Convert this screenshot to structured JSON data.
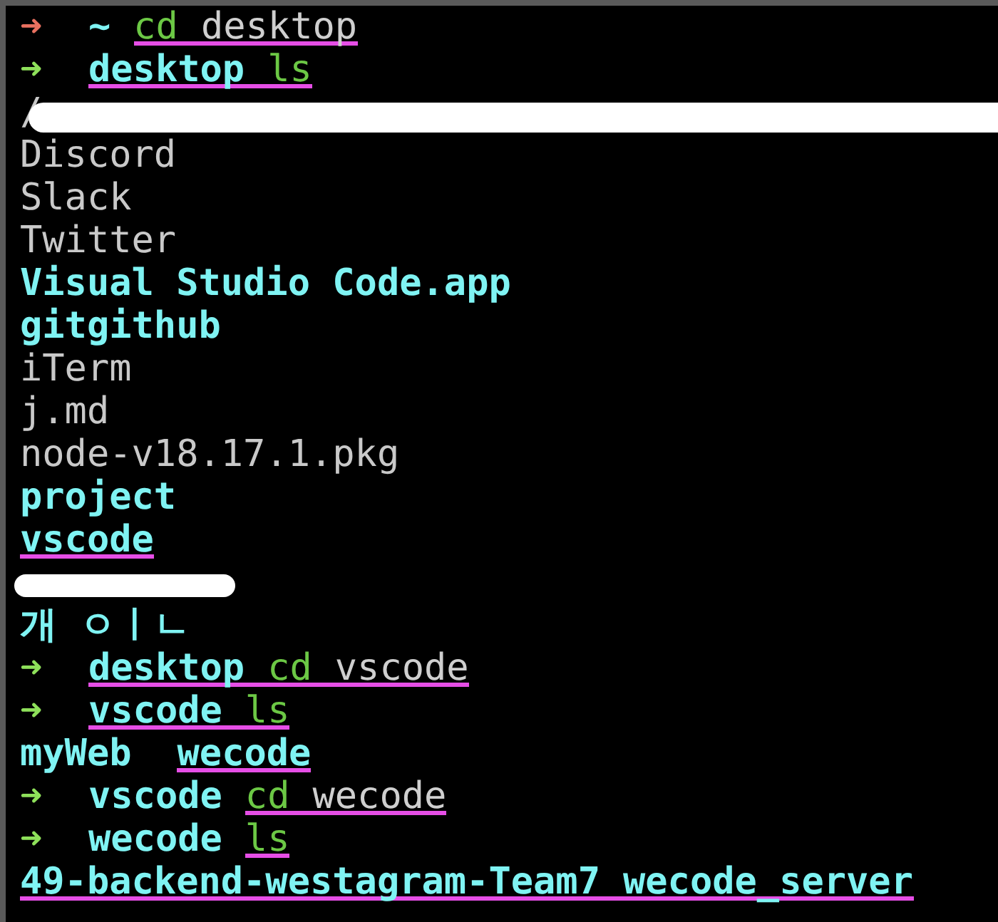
{
  "lines": [
    {
      "kind": "prompt",
      "arrow": "➜",
      "error": true,
      "segments": [
        {
          "text": "~",
          "kind": "dir",
          "marked": false
        },
        {
          "text": "cd",
          "kind": "cmd",
          "marked": true
        },
        {
          "text": "desktop",
          "kind": "arg",
          "marked": true
        }
      ]
    },
    {
      "kind": "prompt",
      "arrow": "➜",
      "error": false,
      "segments": [
        {
          "text": "desktop",
          "kind": "dir",
          "marked": true
        },
        {
          "text": "ls",
          "kind": "cmd",
          "marked": true
        }
      ]
    },
    {
      "kind": "redacted",
      "segments": [
        {
          "text": "/",
          "kind": "file",
          "marked": false
        }
      ]
    },
    {
      "kind": "output",
      "segments": [
        {
          "text": "Discord",
          "kind": "file",
          "marked": false
        }
      ]
    },
    {
      "kind": "output",
      "segments": [
        {
          "text": "Slack",
          "kind": "file",
          "marked": false
        }
      ]
    },
    {
      "kind": "output",
      "segments": [
        {
          "text": "Twitter",
          "kind": "file",
          "marked": false
        }
      ]
    },
    {
      "kind": "output",
      "segments": [
        {
          "text": "Visual Studio Code.app",
          "kind": "folder",
          "marked": false
        }
      ]
    },
    {
      "kind": "output",
      "segments": [
        {
          "text": "gitgithub",
          "kind": "folder",
          "marked": false
        }
      ]
    },
    {
      "kind": "output",
      "segments": [
        {
          "text": "iTerm",
          "kind": "file",
          "marked": false
        }
      ]
    },
    {
      "kind": "output",
      "segments": [
        {
          "text": "j.md",
          "kind": "file",
          "marked": false
        }
      ]
    },
    {
      "kind": "output",
      "segments": [
        {
          "text": "node-v18.17.1.pkg",
          "kind": "file",
          "marked": false
        }
      ]
    },
    {
      "kind": "output",
      "segments": [
        {
          "text": "project",
          "kind": "folder",
          "marked": false
        }
      ]
    },
    {
      "kind": "output",
      "segments": [
        {
          "text": "vscode",
          "kind": "folder",
          "marked": true
        }
      ]
    },
    {
      "kind": "redacted"
    },
    {
      "kind": "output",
      "segments": [
        {
          "text": "개 ㅇㅣㄴ",
          "kind": "folder",
          "marked": false
        }
      ]
    },
    {
      "kind": "prompt",
      "arrow": "➜",
      "error": false,
      "segments": [
        {
          "text": "desktop",
          "kind": "dir",
          "marked": true
        },
        {
          "text": "cd",
          "kind": "cmd",
          "marked": true
        },
        {
          "text": "vscode",
          "kind": "arg",
          "marked": true
        }
      ]
    },
    {
      "kind": "prompt",
      "arrow": "➜",
      "error": false,
      "segments": [
        {
          "text": "vscode",
          "kind": "dir",
          "marked": true
        },
        {
          "text": "ls",
          "kind": "cmd",
          "marked": true
        }
      ]
    },
    {
      "kind": "columns",
      "segments": [
        {
          "text": "myWeb",
          "kind": "folder",
          "marked": false
        },
        {
          "text": "wecode",
          "kind": "folder",
          "marked": true
        }
      ]
    },
    {
      "kind": "prompt",
      "arrow": "➜",
      "error": false,
      "segments": [
        {
          "text": "vscode",
          "kind": "dir",
          "marked": false
        },
        {
          "text": "cd",
          "kind": "cmd",
          "marked": true
        },
        {
          "text": "wecode",
          "kind": "arg",
          "marked": true
        }
      ]
    },
    {
      "kind": "prompt",
      "arrow": "➜",
      "error": false,
      "segments": [
        {
          "text": "wecode",
          "kind": "dir",
          "marked": false
        },
        {
          "text": "ls",
          "kind": "cmd",
          "marked": true
        }
      ]
    },
    {
      "kind": "output",
      "segments": [
        {
          "text": "49-backend-westagram-Team7",
          "kind": "folder",
          "marked": true
        },
        {
          "text": "wecode_server",
          "kind": "folder",
          "marked": true
        }
      ]
    }
  ]
}
